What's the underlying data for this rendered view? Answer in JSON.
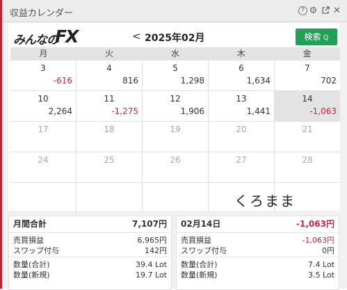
{
  "window": {
    "title": "収益カレンダー"
  },
  "header": {
    "logo_main": "みんなの",
    "logo_fx": "FX",
    "prev": "<",
    "month": "2025年02月",
    "search_label": "検索",
    "search_icon": "Q"
  },
  "weekdays": [
    "月",
    "火",
    "水",
    "木",
    "金"
  ],
  "weeks": [
    [
      {
        "d": "3",
        "v": "-616"
      },
      {
        "d": "4",
        "v": "816"
      },
      {
        "d": "5",
        "v": "1,298"
      },
      {
        "d": "6",
        "v": "1,634"
      },
      {
        "d": "7",
        "v": "702"
      }
    ],
    [
      {
        "d": "10",
        "v": "2,264"
      },
      {
        "d": "11",
        "v": "-1,275"
      },
      {
        "d": "12",
        "v": "1,906"
      },
      {
        "d": "13",
        "v": "1,441"
      },
      {
        "d": "14",
        "v": "-1,063"
      }
    ],
    [
      {
        "d": "17"
      },
      {
        "d": "18"
      },
      {
        "d": "19"
      },
      {
        "d": "20"
      },
      {
        "d": "21"
      }
    ],
    [
      {
        "d": "24"
      },
      {
        "d": "25"
      },
      {
        "d": "26"
      },
      {
        "d": "27"
      },
      {
        "d": "28"
      }
    ]
  ],
  "annotation": "くろまま",
  "summary_month": {
    "title": "月間合計",
    "total": "7,107円",
    "realized_label": "売買損益",
    "realized": "6,965円",
    "swap_label": "スワップ付与",
    "swap": "142円",
    "qty_total_label": "数量(合計)",
    "qty_total": "39.4 Lot",
    "qty_new_label": "数量(新規)",
    "qty_new": "19.7 Lot"
  },
  "summary_day": {
    "title": "02月14日",
    "total": "-1,063円",
    "realized_label": "売買損益",
    "realized": "-1,063円",
    "swap_label": "スワップ付与",
    "swap": "0円",
    "qty_total_label": "数量(合計)",
    "qty_total": "7.4 Lot",
    "qty_new_label": "数量(新規)",
    "qty_new": "3.5 Lot"
  },
  "colors": {
    "accent_red": "#c0232c",
    "negative": "#d6203a",
    "search_green": "#20a255",
    "selected_day": "#e3e3e3"
  },
  "icons": {
    "help": "help-icon",
    "settings": "gear-icon",
    "popout": "popout-icon",
    "close": "close-icon"
  }
}
